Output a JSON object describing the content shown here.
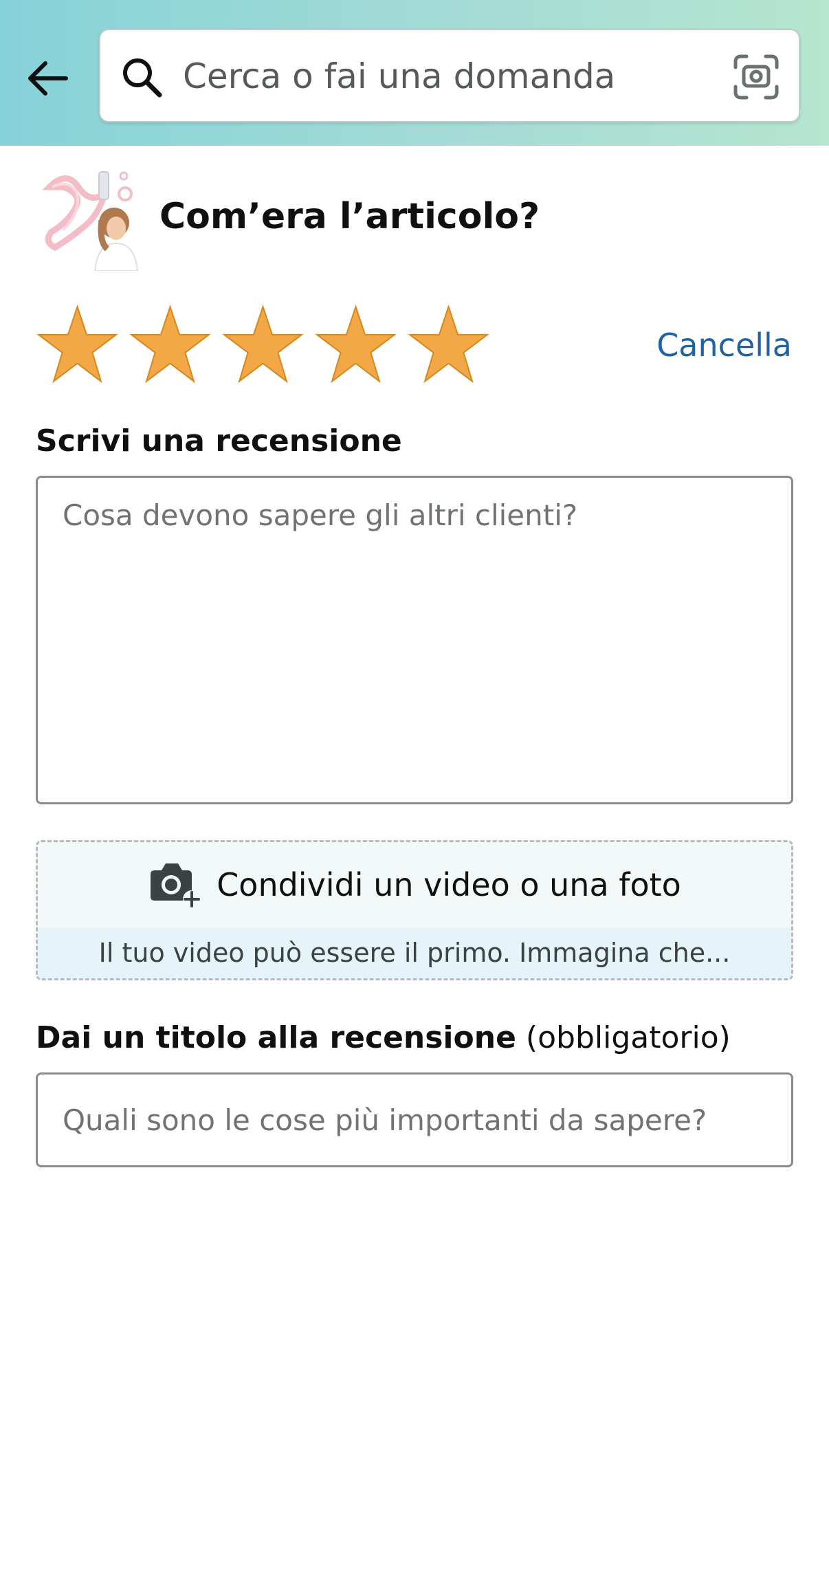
{
  "header": {
    "back_icon": "arrow-left-icon",
    "search": {
      "placeholder": "Cerca o fai una domanda",
      "value": "",
      "search_icon": "search-icon",
      "scan_icon": "camera-scan-icon"
    }
  },
  "product": {
    "thumbnail_icon": "product-thumbnail",
    "question": "Com’era l’articolo?"
  },
  "rating": {
    "value": 5,
    "max": 5,
    "star_color": "#f3a847",
    "clear_label": "Cancella"
  },
  "review": {
    "label": "Scrivi una recensione",
    "placeholder": "Cosa devono sapere gli altri clienti?",
    "value": ""
  },
  "media": {
    "icon": "camera-plus-icon",
    "label": "Condividi un video o una foto",
    "hint": "Il tuo video può essere il primo. Immagina che..."
  },
  "headline": {
    "label": "Dai un titolo alla recensione",
    "required_note": "(obbligatorio)",
    "placeholder": "Quali sono le cose più importanti da sapere?",
    "value": ""
  },
  "colors": {
    "link": "#2162a1",
    "header_gradient_start": "#86d2d9",
    "header_gradient_end": "#b5e6cf"
  }
}
